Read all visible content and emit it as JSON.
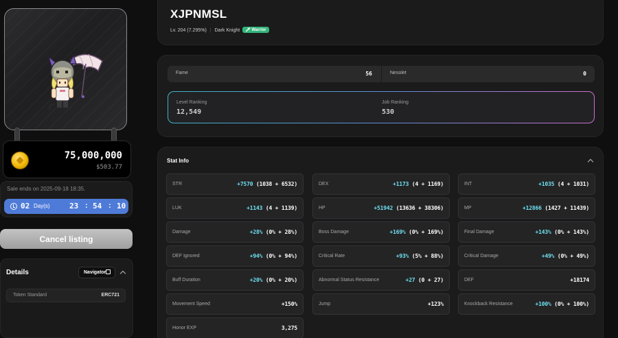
{
  "listing": {
    "price": "75,000,000",
    "price_usd": "$503.77",
    "sale_ends": "Sale ends on 2025-09-18 18:35.",
    "timer": {
      "days": "02",
      "days_label": "Day(s)",
      "hours": "23",
      "minutes": "54",
      "seconds": "10"
    },
    "cancel_label": "Cancel listing"
  },
  "details": {
    "title": "Details",
    "navigator_label": "Navigator",
    "token_standard_label": "Token Standard",
    "token_standard_value": "ERC721"
  },
  "character": {
    "name": "XJPNMSL",
    "level": "Lv. 204 (7.295%)",
    "job": "Dark Knight",
    "class_badge": "Warrior"
  },
  "info": {
    "fame_label": "Fame",
    "fame_value": "56",
    "nesolet_label": "Nesolet",
    "nesolet_value": "0",
    "level_ranking_label": "Level Ranking",
    "level_ranking_value": "12,549",
    "job_ranking_label": "Job Ranking",
    "job_ranking_value": "530"
  },
  "stats": {
    "title": "Stat Info",
    "items": [
      {
        "label": "STR",
        "total": "+7570",
        "detail": " (1038 + 6532)"
      },
      {
        "label": "DEX",
        "total": "+1173",
        "detail": " (4 + 1169)"
      },
      {
        "label": "INT",
        "total": "+1035",
        "detail": " (4 + 1031)"
      },
      {
        "label": "LUK",
        "total": "+1143",
        "detail": " (4 + 1139)"
      },
      {
        "label": "HP",
        "total": "+51942",
        "detail": " (13636 + 38306)"
      },
      {
        "label": "MP",
        "total": "+12866",
        "detail": " (1427 + 11439)"
      },
      {
        "label": "Damage",
        "total": "+28%",
        "detail": " (0% + 28%)"
      },
      {
        "label": "Boss Damage",
        "total": "+169%",
        "detail": " (0% + 169%)"
      },
      {
        "label": "Final Damage",
        "total": "+143%",
        "detail": " (0% + 143%)"
      },
      {
        "label": "DEF Ignored",
        "total": "+94%",
        "detail": " (0% + 94%)"
      },
      {
        "label": "Critical Rate",
        "total": "+93%",
        "detail": " (5% + 88%)"
      },
      {
        "label": "Critical Damage",
        "total": "+49%",
        "detail": " (0% + 49%)"
      },
      {
        "label": "Buff Duration",
        "total": "+20%",
        "detail": " (0% + 20%)"
      },
      {
        "label": "Abnormal Status Resistance",
        "total": "+27",
        "detail": " (0 + 27)"
      },
      {
        "label": "DEF",
        "total": "",
        "detail": "+18174"
      },
      {
        "label": "Movement Speed",
        "total": "",
        "detail": "+150%"
      },
      {
        "label": "Jump",
        "total": "",
        "detail": "+123%"
      },
      {
        "label": "Knockback Resistance",
        "total": "+100%",
        "detail": " (0% + 100%)"
      },
      {
        "label": "Honor EXP",
        "total": "",
        "detail": "3,275"
      }
    ]
  },
  "colors": {
    "accent": "#6ee0f0",
    "timer_bg": "#4f7bd8",
    "badge": "#34b57a",
    "coin": "#f2b705"
  }
}
